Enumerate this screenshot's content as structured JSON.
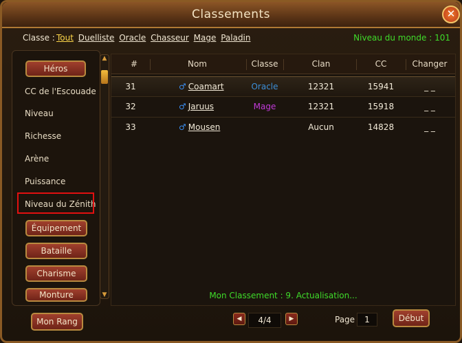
{
  "window": {
    "title": "Classements",
    "close_icon": "close-icon"
  },
  "classbar": {
    "label": "Classe :",
    "links": [
      "Tout",
      "Duelliste",
      "Oracle",
      "Chasseur",
      "Mage",
      "Paladin"
    ],
    "world_level": "Niveau du monde : 101"
  },
  "sidebar": {
    "heros": "Héros",
    "items": [
      "CC de l'Escouade",
      "Niveau",
      "Richesse",
      "Arène",
      "Puissance",
      "Niveau du Zénith"
    ],
    "buttons": [
      "Équipement",
      "Bataille",
      "Charisme",
      "Monture"
    ],
    "mon_rang": "Mon Rang"
  },
  "table": {
    "headers": [
      "#",
      "Nom",
      "Classe",
      "Clan",
      "CC",
      "Changer"
    ],
    "rows": [
      {
        "rank": "31",
        "name": "Coamart",
        "classe": "Oracle",
        "clan": "12321",
        "cc": "15941",
        "change": "_ _"
      },
      {
        "rank": "32",
        "name": "Jaruus",
        "classe": "Mage",
        "clan": "12321",
        "cc": "15918",
        "change": "_ _"
      },
      {
        "rank": "33",
        "name": "Mousen",
        "classe": "",
        "clan": "Aucun",
        "cc": "14828",
        "change": "_ _"
      }
    ],
    "mon_classement": "Mon Classement : 9. Actualisation..."
  },
  "pagination": {
    "pages": "4/4",
    "page_label": "Page",
    "page_value": "1",
    "debut": "Début"
  },
  "colors": {
    "oracle": "#3c8fd8",
    "mage": "#c03ad8",
    "green": "#3fdc2a",
    "gold": "#ffd84a"
  }
}
